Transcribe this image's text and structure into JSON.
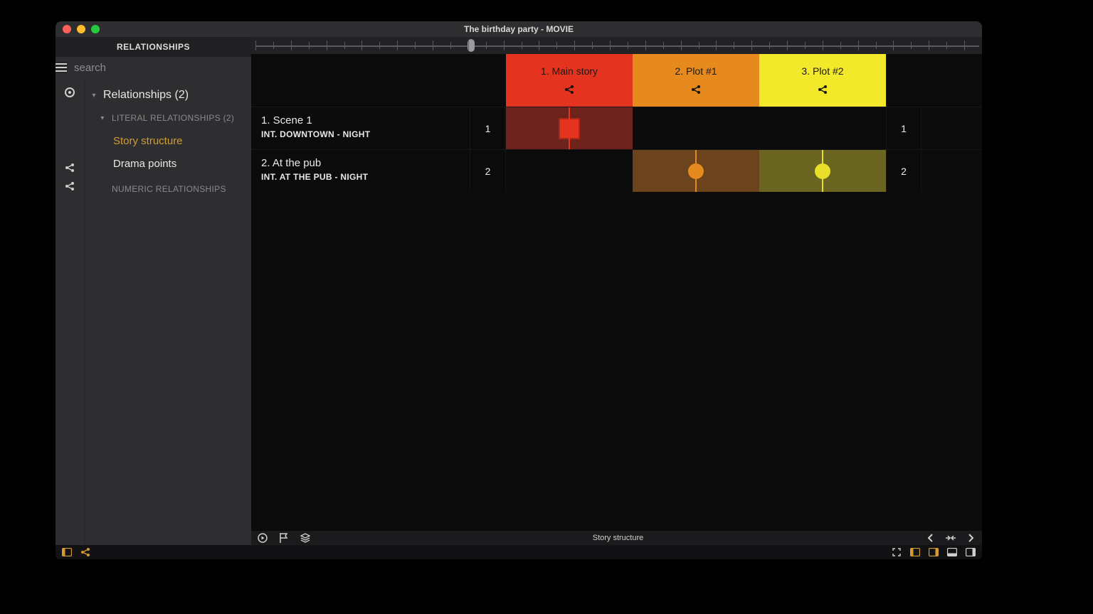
{
  "window": {
    "title": "The birthday party - MOVIE"
  },
  "sidebar": {
    "panel_title": "RELATIONSHIPS",
    "search_placeholder": "search",
    "root_label": "Relationships (2)",
    "section_literal": "LITERAL RELATIONSHIPS (2)",
    "section_numeric": "NUMERIC RELATIONSHIPS",
    "items": [
      {
        "label": "Story structure",
        "selected": true
      },
      {
        "label": "Drama points",
        "selected": false
      }
    ]
  },
  "plots": [
    {
      "label": "1. Main story"
    },
    {
      "label": "2. Plot #1"
    },
    {
      "label": "3. Plot #2"
    }
  ],
  "scenes": [
    {
      "num": "1",
      "title": "1. Scene 1",
      "slug": "INT.  DOWNTOWN - NIGHT",
      "right_num": "1"
    },
    {
      "num": "2",
      "title": "2. At the pub",
      "slug": "INT.  AT THE PUB - NIGHT",
      "right_num": "2"
    }
  ],
  "footer": {
    "view_label": "Story structure"
  }
}
